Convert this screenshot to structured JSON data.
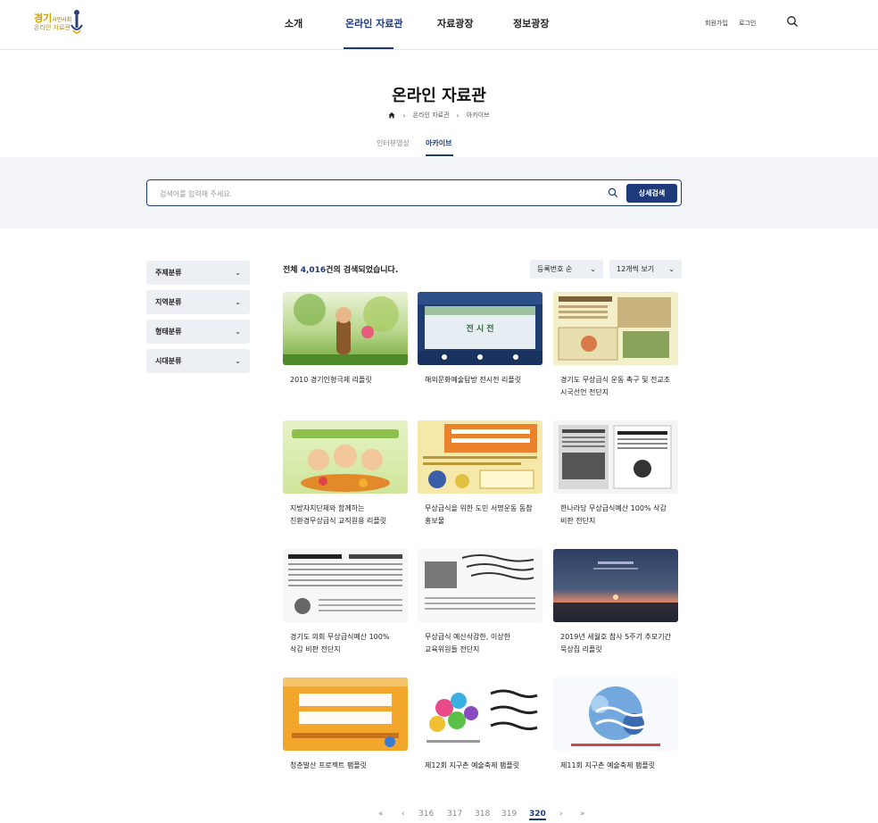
{
  "header": {
    "logo": {
      "main": "경기",
      "small": "시민사회",
      "sub": "온라인 자료관"
    },
    "nav": [
      "소개",
      "온라인 자료관",
      "자료광장",
      "정보광장"
    ],
    "active_nav_index": 1,
    "util": [
      "회원가입",
      "로그인"
    ],
    "search_icon": "search-icon"
  },
  "page": {
    "title": "온라인 자료관",
    "breadcrumb": [
      "온라인 자료관",
      "아카이브"
    ],
    "home_icon": "home-icon",
    "tabs": [
      "인터뷰영상",
      "아카이브"
    ],
    "active_tab_index": 1
  },
  "search": {
    "placeholder": "검색어를 입력해 주세요.",
    "value": "",
    "advanced_label": "상세검색"
  },
  "filters": [
    "주제분류",
    "지역분류",
    "형태분류",
    "시대분류"
  ],
  "results": {
    "prefix": "전체 ",
    "count": "4,016",
    "suffix": "건의 검색되었습니다.",
    "sort": "등록번호 순",
    "per_page": "12개씩 보기"
  },
  "items": [
    {
      "title": [
        "2010 경기인형극제 리플릿"
      ],
      "thumb": "green-puppet-leaflet"
    },
    {
      "title": [
        "해외문화예술탐방 전시전 리플릿"
      ],
      "thumb": "navy-exhibition-leaflet"
    },
    {
      "title": [
        "경기도 무상급식 운동 촉구 및 전교조",
        "시국선언 전단지"
      ],
      "thumb": "cream-document"
    },
    {
      "title": [
        "지방자치단체와 함께하는",
        "친환경무상급식 교직원용 리플릿"
      ],
      "thumb": "green-food-leaflet"
    },
    {
      "title": [
        "무상급식을 위한 도민 서명운동 동참",
        "홍보물"
      ],
      "thumb": "yellow-petition"
    },
    {
      "title": [
        "한나라당 무상급식예산 100% 삭감",
        "비판 전단지"
      ],
      "thumb": "bw-newspaper"
    },
    {
      "title": [
        "경기도 의회 무상급식예산 100%",
        "삭감 비판 전단지"
      ],
      "thumb": "bw-flyer"
    },
    {
      "title": [
        "무상급식 예산삭감한, 이상한",
        "교육위원들 전단지"
      ],
      "thumb": "bw-handwritten"
    },
    {
      "title": [
        "2019년 세월호 참사 5주기 추모기간",
        "묵상집 리플릿"
      ],
      "thumb": "sunset-sea"
    },
    {
      "title": [
        "청춘발산 프로젝트 팸플릿"
      ],
      "thumb": "orange-project"
    },
    {
      "title": [
        "제12회 지구촌 예술축제 팸플릿"
      ],
      "thumb": "colorful-festival"
    },
    {
      "title": [
        "제11회 지구촌 예술축제 팸플릿"
      ],
      "thumb": "blue-festival"
    }
  ],
  "pagination": {
    "first": "«",
    "prev": "‹",
    "next": "›",
    "last": "»",
    "pages": [
      "316",
      "317",
      "318",
      "319",
      "320"
    ],
    "current": "320"
  }
}
